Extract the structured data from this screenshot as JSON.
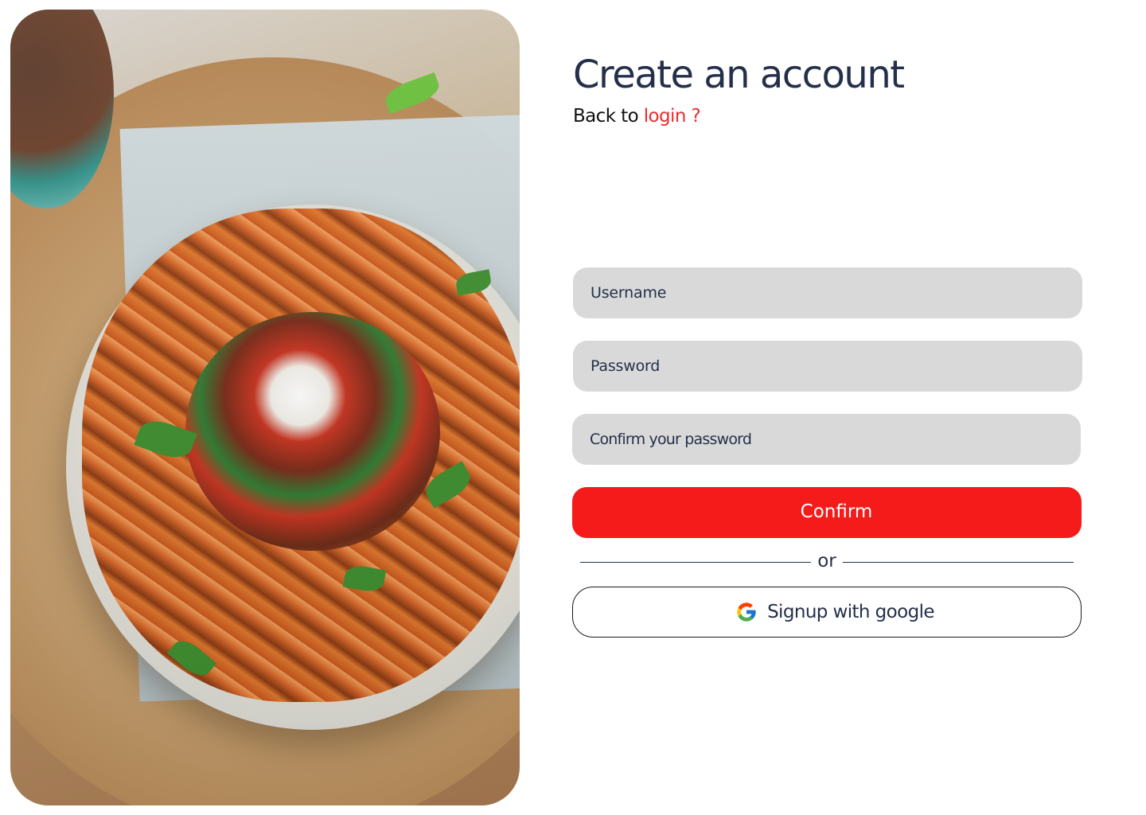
{
  "hero": {
    "image_alt": "Bowl of roasted sweet potato fries topped with salsa, beans, herbs and sour cream"
  },
  "header": {
    "title": "Create an account",
    "back_prefix": "Back to",
    "login_link": "login ?"
  },
  "form": {
    "username_placeholder": "Username",
    "password_placeholder": "Password",
    "confirm_password_placeholder": "Confirm your password",
    "confirm_label": "Confirm",
    "divider_label": "or",
    "google_label": "Signup with google"
  },
  "icons": {
    "google": "google-icon"
  },
  "colors": {
    "title": "#24304a",
    "accent": "#f51b1b",
    "link": "#f02b2b",
    "field_bg": "#d9d9d9"
  }
}
